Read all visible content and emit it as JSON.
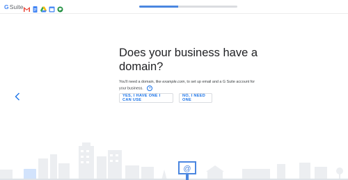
{
  "header": {
    "brand_g": "G",
    "brand_suite": "Suite",
    "app_icons": [
      "gmail-icon",
      "docs-icon",
      "drive-icon",
      "calendar-icon",
      "keep-icon"
    ],
    "progress": 0.4
  },
  "nav": {
    "back_icon": "chevron-left-icon"
  },
  "main": {
    "title": "Does your business have a domain?",
    "description_before": "You'll need a domain, like ",
    "description_example": "example.com",
    "description_after": ", to set up email and a G Suite account for your business.",
    "help_icon": "?"
  },
  "actions": {
    "yes_label": "YES, I HAVE ONE I CAN USE",
    "no_label": "NO, I NEED ONE"
  },
  "colors": {
    "accent": "#1a73e8",
    "progress": "#4a86e0",
    "skyline": "#e8eaed"
  }
}
